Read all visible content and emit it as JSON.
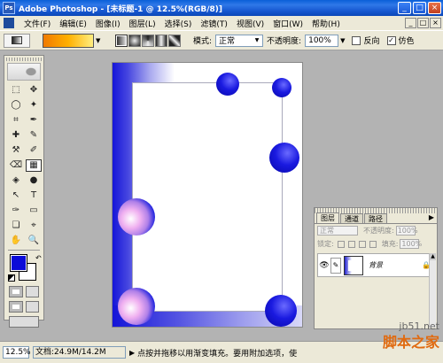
{
  "window": {
    "title": "Adobe Photoshop - [未标题-1 @ 12.5%(RGB/8)]",
    "app_icon": "Ps",
    "controls": [
      "_",
      "□",
      "×"
    ]
  },
  "menubar": {
    "items": [
      "文件(F)",
      "编辑(E)",
      "图像(I)",
      "图层(L)",
      "选择(S)",
      "滤镜(T)",
      "视图(V)",
      "窗口(W)",
      "帮助(H)"
    ],
    "doc_controls": [
      "_",
      "□",
      "×"
    ]
  },
  "options_bar": {
    "mode_label": "模式:",
    "mode_value": "正常",
    "opacity_label": "不透明度:",
    "opacity_value": "100%",
    "reverse_label": "反向",
    "reverse_checked": "",
    "dither_label": "仿色",
    "dither_checked": "✓",
    "dropdown_arrow": "▼",
    "gradient_colors": [
      "#f07a00",
      "#ffb000",
      "#ffee80"
    ]
  },
  "toolbox": {
    "tools": [
      "⬚",
      "✥",
      "◯",
      "✦",
      "⌗",
      "✒",
      "✚",
      "✎",
      "⚒",
      "✐",
      "⌫",
      "▦",
      "◈",
      "●",
      "↖",
      "T",
      "✑",
      "▭",
      "❏",
      "⌖",
      "✋",
      "🔍"
    ],
    "foreground_color": "#0b0bd8",
    "background_color": "#ffffff",
    "swap": "↶"
  },
  "layers_panel": {
    "tabs": [
      "图层",
      "通道",
      "路径"
    ],
    "menu_arrow": "▶",
    "blend_mode": "正常",
    "opacity_label": "不透明度:",
    "opacity_value": "100%",
    "lock_label": "锁定:",
    "fill_label": "填充:",
    "fill_value": "100%",
    "layer_name": "背景",
    "eye_icon": "👁",
    "brush_icon": "✎",
    "lock_icon": "🔒",
    "scroll_up": "▲"
  },
  "statusbar": {
    "zoom": "12.5%",
    "doc_info": "文档:24.9M/14.2M",
    "arrow": "▶",
    "hint": "点按并拖移以用渐变填充。要用附加选项，使"
  },
  "watermark": {
    "url": "jb51.net",
    "name": "脚本之家"
  }
}
